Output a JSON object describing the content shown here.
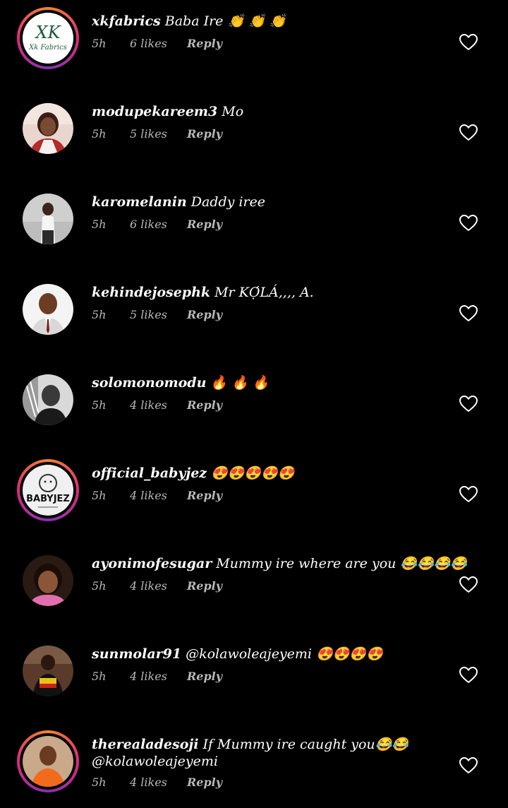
{
  "comments": [
    {
      "username": "xkfabrics",
      "text": "Baba Ire 👏 👏 👏",
      "text2": "",
      "time": "5h",
      "likes": "6 likes",
      "reply": "Reply",
      "avatar_label": "XK",
      "avatar_sub": "Xk Fabrics",
      "story_ring": true
    },
    {
      "username": "modupekareem3",
      "text": "Mo",
      "text2": "",
      "time": "5h",
      "likes": "5 likes",
      "reply": "Reply",
      "story_ring": false
    },
    {
      "username": "karomelanin",
      "text": "Daddy iree",
      "text2": "",
      "time": "5h",
      "likes": "6 likes",
      "reply": "Reply",
      "story_ring": false
    },
    {
      "username": "kehindejosephk",
      "text": "Mr KỌ́LÁ,,,, A.",
      "text2": "",
      "time": "5h",
      "likes": "5 likes",
      "reply": "Reply",
      "story_ring": false
    },
    {
      "username": "solomonomodu",
      "text": "🔥 🔥 🔥",
      "text2": "",
      "time": "5h",
      "likes": "4 likes",
      "reply": "Reply",
      "story_ring": false
    },
    {
      "username": "official_babyjez",
      "text": "😍😍😍😍😍",
      "text2": "",
      "time": "5h",
      "likes": "4 likes",
      "reply": "Reply",
      "avatar_label": "BABYJEZ",
      "story_ring": true
    },
    {
      "username": "ayonimofesugar",
      "text": "Mummy ire where are you 😂😂😂😂",
      "text2": "",
      "time": "5h",
      "likes": "4 likes",
      "reply": "Reply",
      "story_ring": false
    },
    {
      "username": "sunmolar91",
      "text": "@kolawoleajeyemi 😍😍😍😍",
      "text2": "",
      "time": "5h",
      "likes": "4 likes",
      "reply": "Reply",
      "story_ring": false
    },
    {
      "username": "therealadesoji",
      "text": "If Mummy ire caught you😂😂",
      "text2": "@kolawoleajeyemi",
      "time": "5h",
      "likes": "4 likes",
      "reply": "Reply",
      "story_ring": true
    }
  ],
  "icons": {
    "like": "heart-outline-icon"
  },
  "colors": {
    "background": "#000000",
    "text": "#ffffff",
    "meta": "#b8b8b8",
    "story_ring_start": "#f58529",
    "story_ring_mid": "#dd2a7b"
  }
}
